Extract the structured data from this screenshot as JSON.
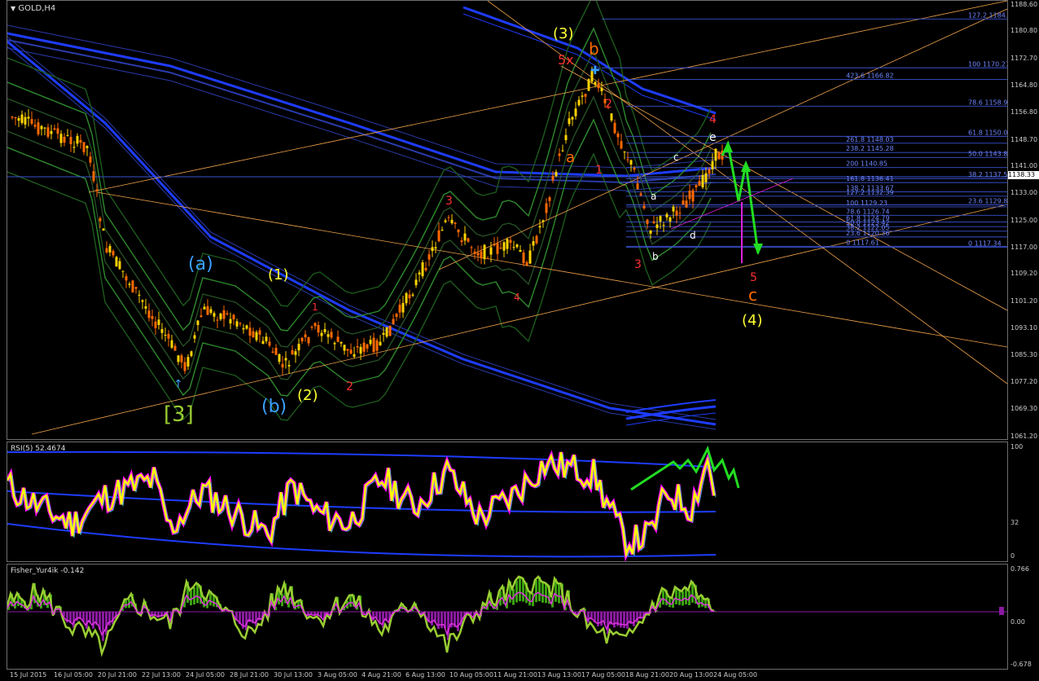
{
  "main": {
    "symbol": "GOLD,H4",
    "current_price": "1138.33",
    "y_ticks": [
      "1188.60",
      "1180.80",
      "1172.70",
      "1164.80",
      "1156.80",
      "1148.70",
      "1141.00",
      "1133.00",
      "1125.00",
      "1117.00",
      "1109.20",
      "1101.20",
      "1093.10",
      "1085.30",
      "1077.20",
      "1069.30",
      "1061.20"
    ],
    "fib_right": [
      {
        "ratio": "127.2",
        "price": "1184.67"
      },
      {
        "ratio": "100",
        "price": "1170.27"
      },
      {
        "ratio": "423.6",
        "price": "1166.82"
      },
      {
        "ratio": "78.6",
        "price": "1158.95"
      },
      {
        "ratio": "61.8",
        "price": "1150.05"
      },
      {
        "ratio": "261.8",
        "price": "1148.03"
      },
      {
        "ratio": "238.2",
        "price": "1145.28"
      },
      {
        "ratio": "50.0",
        "price": "1143.81"
      },
      {
        "ratio": "200",
        "price": "1140.85"
      },
      {
        "ratio": "38.2",
        "price": "1137.58"
      },
      {
        "ratio": "161.8",
        "price": "1136.41"
      },
      {
        "ratio": "138.2",
        "price": "1133.67"
      },
      {
        "ratio": "127.2",
        "price": "1132.39"
      },
      {
        "ratio": "23.6",
        "price": "1129.83"
      },
      {
        "ratio": "100",
        "price": "1129.23"
      },
      {
        "ratio": "78.6",
        "price": "1126.74"
      },
      {
        "ratio": "61.8",
        "price": "1124.79"
      },
      {
        "ratio": "50.0",
        "price": "1123.42"
      },
      {
        "ratio": "38.2",
        "price": "1122.05"
      },
      {
        "ratio": "23.6",
        "price": "1120.36"
      },
      {
        "ratio": "0",
        "price": "1117.61"
      },
      {
        "ratio": "0",
        "price": "1117.34"
      }
    ],
    "wave_labels": {
      "w3_major": "[3]",
      "wa_paren": "(a)",
      "wb_paren": "(b)",
      "w1_paren": "(1)",
      "w2_paren": "(2)",
      "w3_paren": "(3)",
      "w4_paren": "(4)",
      "w5x": "5x",
      "wb": "b",
      "wa": "a",
      "w1": "1",
      "w2": "2",
      "w3": "3",
      "w4": "4",
      "w5": "5",
      "wc": "c",
      "sa": "a",
      "sb": "b",
      "sc": "c",
      "sd": "d",
      "se": "e"
    }
  },
  "rsi": {
    "label": "RSI(5) 52.4674",
    "ticks": [
      "100",
      "32",
      "0"
    ]
  },
  "fisher": {
    "label": "Fisher_Yur4ik -0.142",
    "ticks": [
      "0.766",
      "0.00",
      "-0.678"
    ]
  },
  "time_axis": [
    "15 Jul 2015",
    "16 Jul 05:00",
    "20 Jul 21:00",
    "22 Jul 13:00",
    "24 Jul 05:00",
    "28 Jul 21:00",
    "30 Jul 13:00",
    "3 Aug 05:00",
    "4 Aug 21:00",
    "6 Aug 13:00",
    "10 Aug 05:00",
    "11 Aug 21:00",
    "13 Aug 13:00",
    "17 Aug 05:00",
    "18 Aug 21:00",
    "20 Aug 13:00",
    "24 Aug 05:00"
  ],
  "colors": {
    "bg": "#000000",
    "bull": "#ffd400",
    "bear": "#ff6a00",
    "blue_band": "#1a2cff",
    "green_band": "#2e8b2e",
    "fib": "#3a52d0",
    "orange_line": "#f0a24a",
    "rsi": "#ffff00",
    "rsi_shadow": "#ff00ff",
    "arrow": "#22dd22",
    "hist_up": "#3aa010",
    "hist_down": "#8a1aa0",
    "fisher_line": "#9acd32",
    "signal": "#dd33dd"
  }
}
